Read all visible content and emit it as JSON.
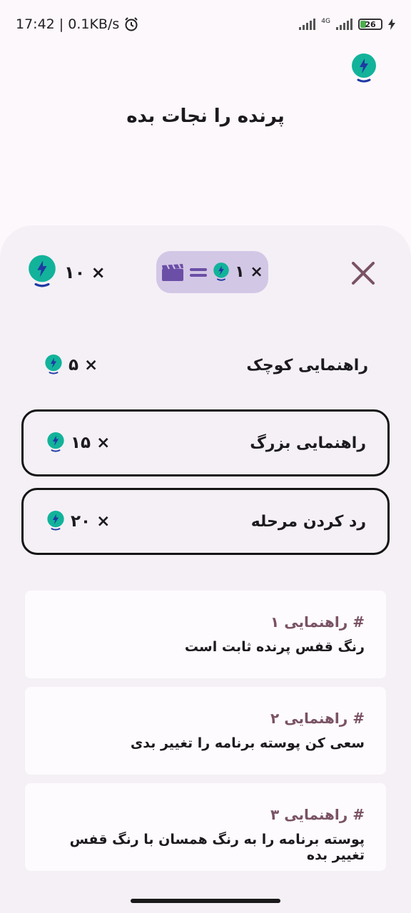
{
  "status_bar": {
    "time_speed": "17:42 | 0.1KB/s",
    "network": "4G",
    "battery": "26"
  },
  "header": {
    "title": "پرنده را نجات بده"
  },
  "balance": {
    "coins": "× ۱۰"
  },
  "ad_offer": {
    "reward": "× ۱"
  },
  "options": [
    {
      "label": "راهنمایی کوچک",
      "cost": "× ۵"
    },
    {
      "label": "راهنمایی بزرگ",
      "cost": "× ۱۵"
    },
    {
      "label": "رد کردن مرحله",
      "cost": "× ۲۰"
    }
  ],
  "hints": [
    {
      "title": "# راهنمایی ۱",
      "text": "رنگ قفس پرنده ثابت است"
    },
    {
      "title": "# راهنمایی ۲",
      "text": "سعی کن پوسته برنامه را تغییر بدی"
    },
    {
      "title": "# راهنمایی ۳",
      "text": "پوسته برنامه را به رنگ همسان با رنگ قفس تغییر بده"
    }
  ],
  "icons": {
    "bulb": "lightbulb-bolt-icon",
    "ad": "clapperboard-icon",
    "close": "close-icon",
    "alarm": "alarm-icon"
  },
  "colors": {
    "bulb_teal": "#12b39a",
    "bulb_blue": "#1f3aa3",
    "sheet_bg": "#f4f0f6",
    "pill_bg": "#d3c7e6",
    "accent_purple": "#6b4fa6",
    "close_color": "#7a5264",
    "hint_title": "#7a5264"
  }
}
